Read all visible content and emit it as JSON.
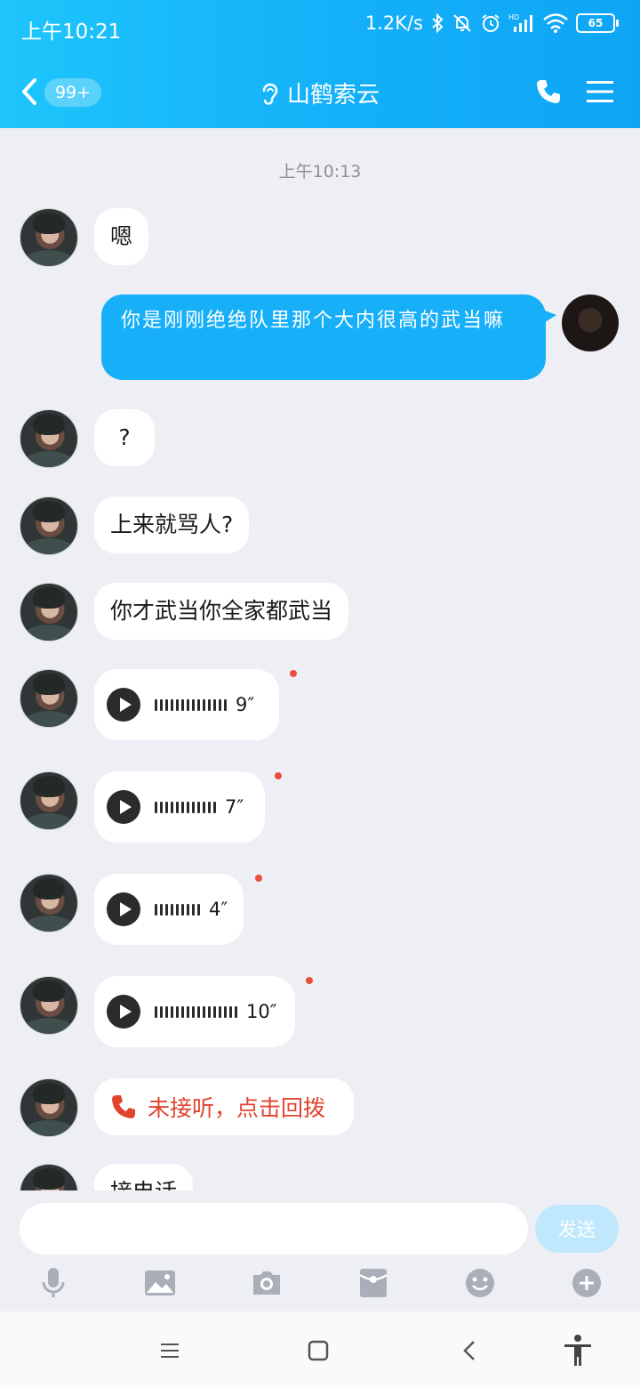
{
  "status_bar": {
    "time": "上午10:21",
    "net_speed": "1.2K/s",
    "battery": "65"
  },
  "nav": {
    "unread_badge": "99+",
    "contact_name": "山鹤索云"
  },
  "chat": {
    "timestamp": "上午10:13",
    "messages": [
      {
        "from": "contact",
        "type": "text",
        "text": "嗯"
      },
      {
        "from": "self",
        "type": "text",
        "text": "你是刚刚绝绝队里那个大内很高的武当嘛"
      },
      {
        "from": "contact",
        "type": "text",
        "text": "?"
      },
      {
        "from": "contact",
        "type": "text",
        "text": "上来就骂人?"
      },
      {
        "from": "contact",
        "type": "text",
        "text": "你才武当你全家都武当"
      },
      {
        "from": "contact",
        "type": "voice",
        "duration": "9″",
        "unread": true
      },
      {
        "from": "contact",
        "type": "voice",
        "duration": "7″",
        "unread": true
      },
      {
        "from": "contact",
        "type": "voice",
        "duration": "4″",
        "unread": true
      },
      {
        "from": "contact",
        "type": "voice",
        "duration": "10″",
        "unread": true
      },
      {
        "from": "contact",
        "type": "missed_call",
        "text": "未接听，点击回拨"
      },
      {
        "from": "contact",
        "type": "text",
        "text": "接电话"
      }
    ]
  },
  "input": {
    "placeholder": "",
    "send_label": "发送"
  },
  "toolbar": [
    "microphone-icon",
    "image-icon",
    "camera-icon",
    "red-packet-icon",
    "emoji-icon",
    "plus-icon"
  ],
  "colors": {
    "header": "#13b0f8",
    "self_bubble": "#17aff8",
    "missed_call": "#e0442f",
    "unread_dot": "#e8503a"
  }
}
